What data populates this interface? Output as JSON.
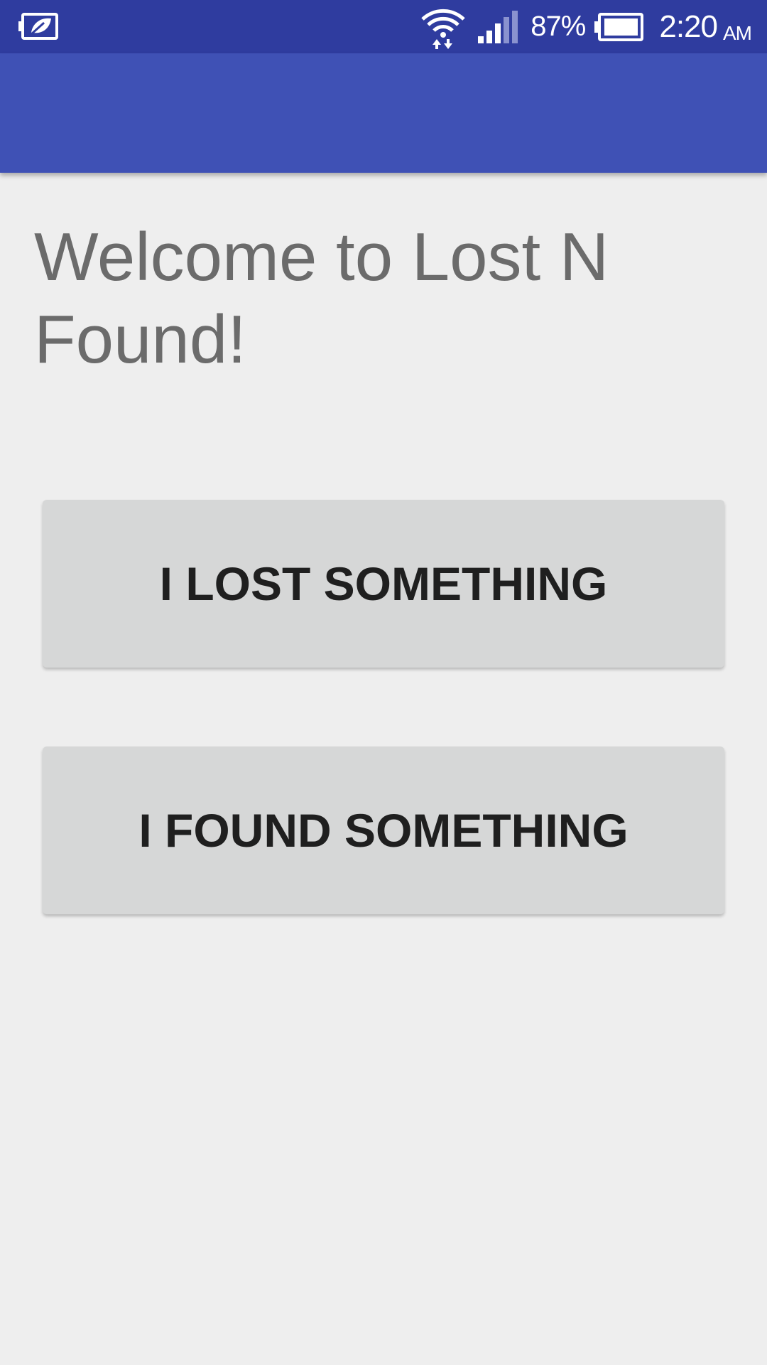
{
  "status_bar": {
    "left_icon": "battery-saver-leaf-icon",
    "wifi_icon": "wifi-data-icon",
    "signal_icon": "cell-signal-icon",
    "battery_percent": "87%",
    "battery_icon": "battery-icon",
    "time": "2:20",
    "ampm": "AM",
    "colors": {
      "background": "#2f3c9f",
      "foreground": "#ffffff"
    }
  },
  "app_bar": {
    "color": "#3f51b5"
  },
  "main": {
    "welcome_text": "Welcome to Lost N Found!",
    "lost_button_label": "I LOST SOMETHING",
    "found_button_label": "I FOUND SOMETHING"
  }
}
